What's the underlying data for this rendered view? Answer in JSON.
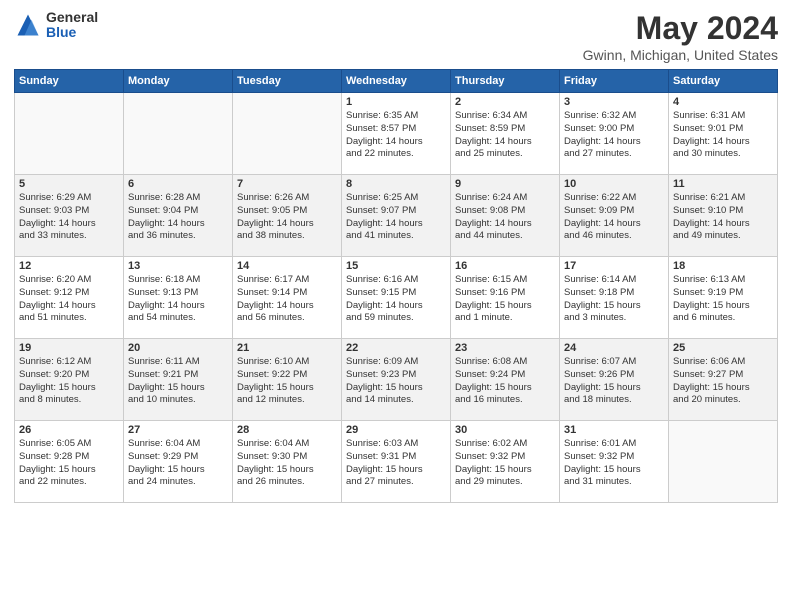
{
  "logo": {
    "general": "General",
    "blue": "Blue"
  },
  "title": "May 2024",
  "subtitle": "Gwinn, Michigan, United States",
  "days_of_week": [
    "Sunday",
    "Monday",
    "Tuesday",
    "Wednesday",
    "Thursday",
    "Friday",
    "Saturday"
  ],
  "weeks": [
    [
      {
        "day": "",
        "lines": []
      },
      {
        "day": "",
        "lines": []
      },
      {
        "day": "",
        "lines": []
      },
      {
        "day": "1",
        "lines": [
          "Sunrise: 6:35 AM",
          "Sunset: 8:57 PM",
          "Daylight: 14 hours",
          "and 22 minutes."
        ]
      },
      {
        "day": "2",
        "lines": [
          "Sunrise: 6:34 AM",
          "Sunset: 8:59 PM",
          "Daylight: 14 hours",
          "and 25 minutes."
        ]
      },
      {
        "day": "3",
        "lines": [
          "Sunrise: 6:32 AM",
          "Sunset: 9:00 PM",
          "Daylight: 14 hours",
          "and 27 minutes."
        ]
      },
      {
        "day": "4",
        "lines": [
          "Sunrise: 6:31 AM",
          "Sunset: 9:01 PM",
          "Daylight: 14 hours",
          "and 30 minutes."
        ]
      }
    ],
    [
      {
        "day": "5",
        "lines": [
          "Sunrise: 6:29 AM",
          "Sunset: 9:03 PM",
          "Daylight: 14 hours",
          "and 33 minutes."
        ]
      },
      {
        "day": "6",
        "lines": [
          "Sunrise: 6:28 AM",
          "Sunset: 9:04 PM",
          "Daylight: 14 hours",
          "and 36 minutes."
        ]
      },
      {
        "day": "7",
        "lines": [
          "Sunrise: 6:26 AM",
          "Sunset: 9:05 PM",
          "Daylight: 14 hours",
          "and 38 minutes."
        ]
      },
      {
        "day": "8",
        "lines": [
          "Sunrise: 6:25 AM",
          "Sunset: 9:07 PM",
          "Daylight: 14 hours",
          "and 41 minutes."
        ]
      },
      {
        "day": "9",
        "lines": [
          "Sunrise: 6:24 AM",
          "Sunset: 9:08 PM",
          "Daylight: 14 hours",
          "and 44 minutes."
        ]
      },
      {
        "day": "10",
        "lines": [
          "Sunrise: 6:22 AM",
          "Sunset: 9:09 PM",
          "Daylight: 14 hours",
          "and 46 minutes."
        ]
      },
      {
        "day": "11",
        "lines": [
          "Sunrise: 6:21 AM",
          "Sunset: 9:10 PM",
          "Daylight: 14 hours",
          "and 49 minutes."
        ]
      }
    ],
    [
      {
        "day": "12",
        "lines": [
          "Sunrise: 6:20 AM",
          "Sunset: 9:12 PM",
          "Daylight: 14 hours",
          "and 51 minutes."
        ]
      },
      {
        "day": "13",
        "lines": [
          "Sunrise: 6:18 AM",
          "Sunset: 9:13 PM",
          "Daylight: 14 hours",
          "and 54 minutes."
        ]
      },
      {
        "day": "14",
        "lines": [
          "Sunrise: 6:17 AM",
          "Sunset: 9:14 PM",
          "Daylight: 14 hours",
          "and 56 minutes."
        ]
      },
      {
        "day": "15",
        "lines": [
          "Sunrise: 6:16 AM",
          "Sunset: 9:15 PM",
          "Daylight: 14 hours",
          "and 59 minutes."
        ]
      },
      {
        "day": "16",
        "lines": [
          "Sunrise: 6:15 AM",
          "Sunset: 9:16 PM",
          "Daylight: 15 hours",
          "and 1 minute."
        ]
      },
      {
        "day": "17",
        "lines": [
          "Sunrise: 6:14 AM",
          "Sunset: 9:18 PM",
          "Daylight: 15 hours",
          "and 3 minutes."
        ]
      },
      {
        "day": "18",
        "lines": [
          "Sunrise: 6:13 AM",
          "Sunset: 9:19 PM",
          "Daylight: 15 hours",
          "and 6 minutes."
        ]
      }
    ],
    [
      {
        "day": "19",
        "lines": [
          "Sunrise: 6:12 AM",
          "Sunset: 9:20 PM",
          "Daylight: 15 hours",
          "and 8 minutes."
        ]
      },
      {
        "day": "20",
        "lines": [
          "Sunrise: 6:11 AM",
          "Sunset: 9:21 PM",
          "Daylight: 15 hours",
          "and 10 minutes."
        ]
      },
      {
        "day": "21",
        "lines": [
          "Sunrise: 6:10 AM",
          "Sunset: 9:22 PM",
          "Daylight: 15 hours",
          "and 12 minutes."
        ]
      },
      {
        "day": "22",
        "lines": [
          "Sunrise: 6:09 AM",
          "Sunset: 9:23 PM",
          "Daylight: 15 hours",
          "and 14 minutes."
        ]
      },
      {
        "day": "23",
        "lines": [
          "Sunrise: 6:08 AM",
          "Sunset: 9:24 PM",
          "Daylight: 15 hours",
          "and 16 minutes."
        ]
      },
      {
        "day": "24",
        "lines": [
          "Sunrise: 6:07 AM",
          "Sunset: 9:26 PM",
          "Daylight: 15 hours",
          "and 18 minutes."
        ]
      },
      {
        "day": "25",
        "lines": [
          "Sunrise: 6:06 AM",
          "Sunset: 9:27 PM",
          "Daylight: 15 hours",
          "and 20 minutes."
        ]
      }
    ],
    [
      {
        "day": "26",
        "lines": [
          "Sunrise: 6:05 AM",
          "Sunset: 9:28 PM",
          "Daylight: 15 hours",
          "and 22 minutes."
        ]
      },
      {
        "day": "27",
        "lines": [
          "Sunrise: 6:04 AM",
          "Sunset: 9:29 PM",
          "Daylight: 15 hours",
          "and 24 minutes."
        ]
      },
      {
        "day": "28",
        "lines": [
          "Sunrise: 6:04 AM",
          "Sunset: 9:30 PM",
          "Daylight: 15 hours",
          "and 26 minutes."
        ]
      },
      {
        "day": "29",
        "lines": [
          "Sunrise: 6:03 AM",
          "Sunset: 9:31 PM",
          "Daylight: 15 hours",
          "and 27 minutes."
        ]
      },
      {
        "day": "30",
        "lines": [
          "Sunrise: 6:02 AM",
          "Sunset: 9:32 PM",
          "Daylight: 15 hours",
          "and 29 minutes."
        ]
      },
      {
        "day": "31",
        "lines": [
          "Sunrise: 6:01 AM",
          "Sunset: 9:32 PM",
          "Daylight: 15 hours",
          "and 31 minutes."
        ]
      },
      {
        "day": "",
        "lines": []
      }
    ]
  ]
}
